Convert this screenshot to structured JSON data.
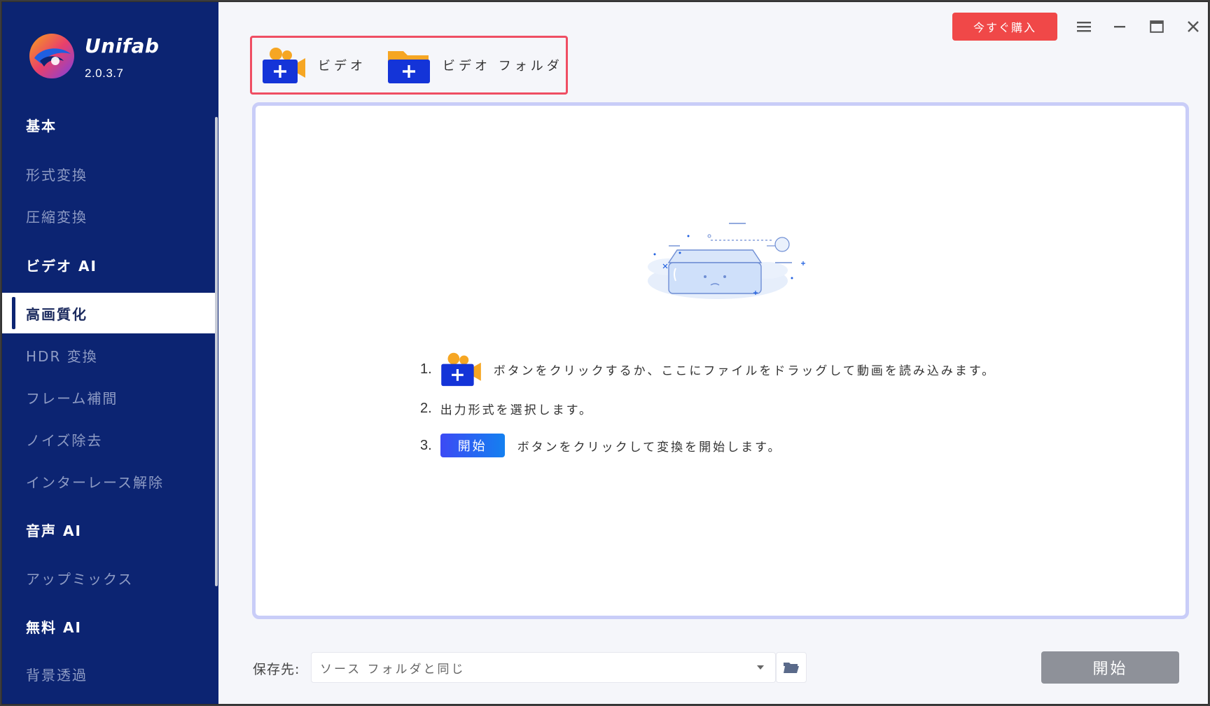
{
  "app": {
    "name": "Unifab",
    "version": "2.0.3.7"
  },
  "titlebar": {
    "buy_label": "今すぐ購入"
  },
  "sidebar": {
    "sections": [
      {
        "label": "基本",
        "items": [
          {
            "label": "形式変換"
          },
          {
            "label": "圧縮変換"
          }
        ]
      },
      {
        "label": "ビデオ AI",
        "items": [
          {
            "label": "高画質化",
            "active": true
          },
          {
            "label": "HDR 変換"
          },
          {
            "label": "フレーム補間"
          },
          {
            "label": "ノイズ除去"
          },
          {
            "label": "インターレース解除"
          }
        ]
      },
      {
        "label": "音声 AI",
        "items": [
          {
            "label": "アップミックス"
          }
        ]
      },
      {
        "label": "無料 AI",
        "items": [
          {
            "label": "背景透過"
          }
        ]
      }
    ]
  },
  "toolbar": {
    "add_video_label": "ビデオ",
    "add_folder_label": "ビデオ フォルダ"
  },
  "dropzone": {
    "steps": [
      {
        "num": "1.",
        "text": "ボタンをクリックするか、ここにファイルをドラッグして動画を読み込みます。"
      },
      {
        "num": "2.",
        "text": "出力形式を選択します。"
      },
      {
        "num": "3.",
        "button": "開始",
        "text": "ボタンをクリックして変換を開始します。"
      }
    ]
  },
  "footer": {
    "save_label": "保存先:",
    "save_value": "ソース フォルダと同じ",
    "start_label": "開始"
  },
  "colors": {
    "sidebar_bg": "#0c2472",
    "accent_red": "#f04848",
    "highlight_border": "#ef4e63",
    "dropzone_border": "#c9cdf8",
    "start_disabled": "#8e9199"
  }
}
